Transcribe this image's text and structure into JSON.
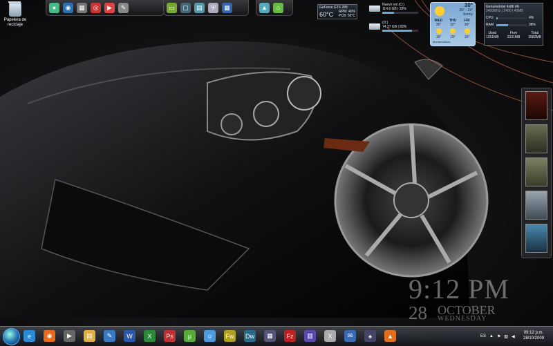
{
  "desktop": {
    "recycle_bin_label": "Papelera de reciclaje"
  },
  "dock_left": {
    "icons": [
      "finder-icon",
      "globe-icon",
      "calculator-icon",
      "chrome-icon",
      "media-icon",
      "tools-icon"
    ]
  },
  "dock_mid": {
    "icons": [
      "monitor-icon",
      "window-icon",
      "folder-icon",
      "shield-icon",
      "grid-icon"
    ]
  },
  "dock_right": {
    "icons": [
      "folder-up-icon",
      "home-icon"
    ]
  },
  "gpu_gadget": {
    "name": "GeForce GTX 285",
    "temperature": "60°C",
    "label_right": "PCB: 56°C",
    "small": "RPM: 40%"
  },
  "drives_gadget": {
    "drives": [
      {
        "name": "Nuevo vol (C:)",
        "detail": "114.6 GB | 33%",
        "percent": 33
      },
      {
        "name": "(D:)",
        "detail": "74.27 GB | 83%",
        "percent": 83
      }
    ]
  },
  "weather_gadget": {
    "current_temp": "30°",
    "range": "35° - 19°",
    "condition": "Sunny",
    "location": "Montemorelos",
    "days": [
      {
        "name": "WED",
        "high": "35°",
        "low": "19°"
      },
      {
        "name": "THU",
        "high": "32°",
        "low": "19°"
      },
      {
        "name": "FRI",
        "high": "30°",
        "low": "16°"
      }
    ]
  },
  "cpu_gadget": {
    "title": "GenuineIntel 4x86 (4)",
    "subtitle": "2400MHz | 2400 | 40MB",
    "cpu_label": "CPU",
    "cpu_value": "4%",
    "cpu_percent": 4,
    "ram_label": "RAM",
    "ram_value": "38%",
    "ram_percent": 38,
    "mem": [
      {
        "label": "Used",
        "value": "1251MB"
      },
      {
        "label": "Free",
        "value": "2231MB"
      },
      {
        "label": "Total",
        "value": "3582MB"
      }
    ]
  },
  "clock": {
    "time": "9:12 PM",
    "day": "28",
    "month": "OCTOBER",
    "weekday": "WEDNESDAY"
  },
  "taskbar": {
    "pinned": [
      "internet-explorer-icon",
      "firefox-icon",
      "media-player-icon",
      "explorer-icon",
      "paint-icon",
      "word-icon",
      "excel-icon",
      "photoshop-icon",
      "utorrent-icon",
      "messenger-icon",
      "fireworks-icon",
      "dreamweaver-icon",
      "network-icon",
      "filezilla-icon",
      "winrar-icon",
      "xfire-icon",
      "chat-icon",
      "games-icon",
      "vlc-icon"
    ],
    "language": "ES",
    "time": "09:12 p.m.",
    "date": "28/10/2009"
  },
  "colors": {
    "accent": "#2a7ab8",
    "clock_text": "#bebebe",
    "weather_bg": "#7ba6d0"
  }
}
